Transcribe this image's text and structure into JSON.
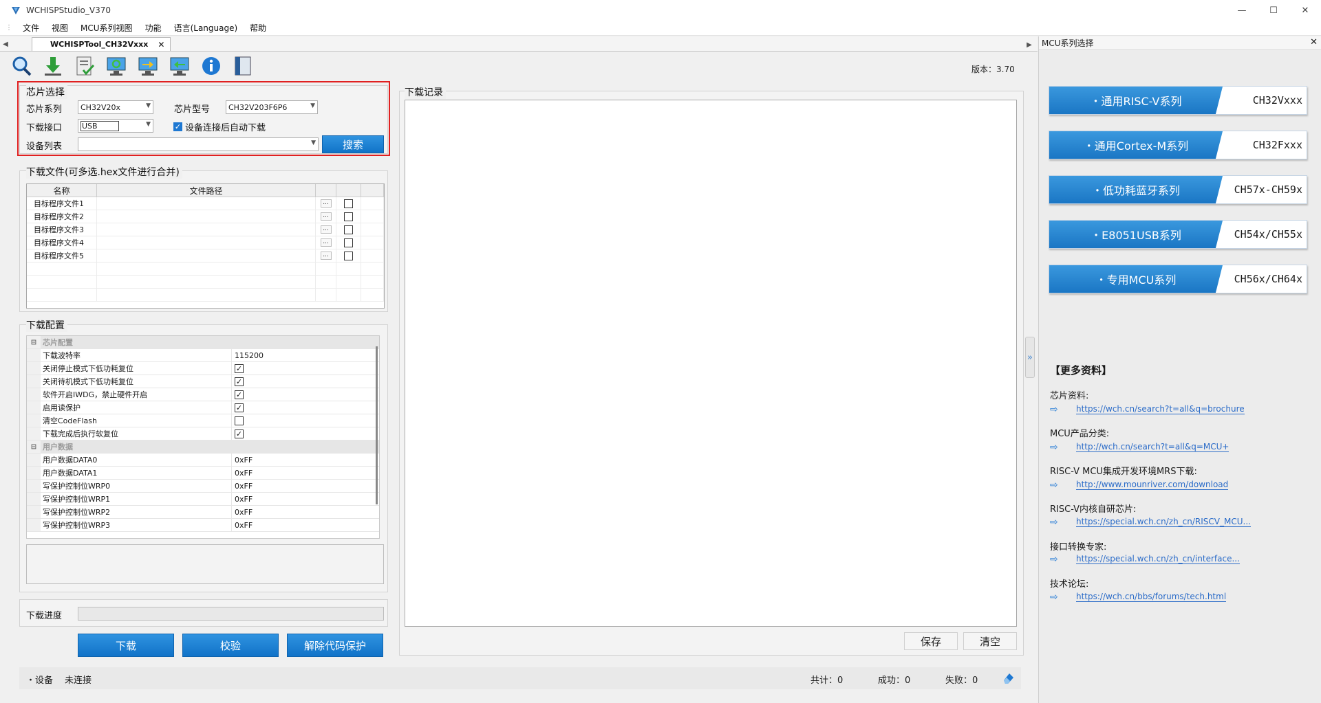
{
  "window": {
    "title": "WCHISPStudio_V370",
    "controls": [
      "—",
      "☐",
      "✕"
    ]
  },
  "menu": [
    "文件",
    "视图",
    "MCU系列视图",
    "功能",
    "语言(Language)",
    "帮助"
  ],
  "tab": {
    "label": "WCHISPTool_CH32Vxxx",
    "close": "✕"
  },
  "version": "版本：3.70",
  "chip_select": {
    "title": "芯片选择",
    "series_label": "芯片系列",
    "series_value": "CH32V20x",
    "model_label": "芯片型号",
    "model_value": "CH32V203F6P6",
    "iface_label": "下载接口",
    "iface_value": "USB",
    "auto_download_label": "设备连接后自动下载",
    "auto_download_checked": true,
    "device_list_label": "设备列表",
    "device_list_value": "",
    "search_button": "搜索"
  },
  "download_files": {
    "title": "下载文件(可多选.hex文件进行合并)",
    "col_name": "名称",
    "col_path": "文件路径",
    "browse_label": "...",
    "rows": [
      {
        "name": "目标程序文件1",
        "path": "",
        "checked": false
      },
      {
        "name": "目标程序文件2",
        "path": "",
        "checked": false
      },
      {
        "name": "目标程序文件3",
        "path": "",
        "checked": false
      },
      {
        "name": "目标程序文件4",
        "path": "",
        "checked": false
      },
      {
        "name": "目标程序文件5",
        "path": "",
        "checked": false
      }
    ]
  },
  "download_config": {
    "title": "下载配置",
    "collapse_sign": "⊟",
    "check_mark": "✓",
    "cat_chip": "芯片配置",
    "baud_label": "下载波特率",
    "baud_value": "115200",
    "options": [
      {
        "label": "关闭停止模式下低功耗复位",
        "checked": true
      },
      {
        "label": "关闭待机模式下低功耗复位",
        "checked": true
      },
      {
        "label": "软件开启IWDG，禁止硬件开启",
        "checked": true
      },
      {
        "label": "启用读保护",
        "checked": true
      },
      {
        "label": "清空CodeFlash",
        "checked": false
      },
      {
        "label": "下载完成后执行软复位",
        "checked": true
      }
    ],
    "cat_user": "用户数据",
    "user_data": [
      {
        "label": "用户数据DATA0",
        "value": "0xFF"
      },
      {
        "label": "用户数据DATA1",
        "value": "0xFF"
      },
      {
        "label": "写保护控制位WRP0",
        "value": "0xFF"
      },
      {
        "label": "写保护控制位WRP1",
        "value": "0xFF"
      },
      {
        "label": "写保护控制位WRP2",
        "value": "0xFF"
      },
      {
        "label": "写保护控制位WRP3",
        "value": "0xFF"
      }
    ]
  },
  "progress": {
    "label": "下载进度",
    "value": 0
  },
  "actions": {
    "download": "下载",
    "verify": "校验",
    "unprotect": "解除代码保护"
  },
  "log": {
    "title": "下载记录",
    "save": "保存",
    "clear": "清空"
  },
  "status": {
    "device_label": "・设备",
    "device_value": "未连接",
    "total": "共计：0",
    "success": "成功：0",
    "fail": "失败：0"
  },
  "right_panel": {
    "title": "MCU系列选择",
    "close": "✕",
    "series": [
      {
        "name": "・通用RISC-V系列",
        "code": "CH32Vxxx"
      },
      {
        "name": "・通用Cortex-M系列",
        "code": "CH32Fxxx"
      },
      {
        "name": "・低功耗蓝牙系列",
        "code": "CH57x-CH59x"
      },
      {
        "name": "・E8051USB系列",
        "code": "CH54x/CH55x"
      },
      {
        "name": "・专用MCU系列",
        "code": "CH56x/CH64x"
      }
    ],
    "more_title": "【更多资料】",
    "arrow": "⇨",
    "links": [
      {
        "label": "芯片资料:",
        "url": "https://wch.cn/search?t=all&q=brochure"
      },
      {
        "label": "MCU产品分类:",
        "url": "http://wch.cn/search?t=all&q=MCU+"
      },
      {
        "label": "RISC-V MCU集成开发环境MRS下载:",
        "url": "http://www.mounriver.com/download"
      },
      {
        "label": "RISC-V内核自研芯片:",
        "url": "https://special.wch.cn/zh_cn/RISCV_MCU..."
      },
      {
        "label": "接口转换专家:",
        "url": "https://special.wch.cn/zh_cn/interface..."
      },
      {
        "label": "技术论坛:",
        "url": "https://wch.cn/bbs/forums/tech.html"
      }
    ],
    "splitter": "»"
  }
}
